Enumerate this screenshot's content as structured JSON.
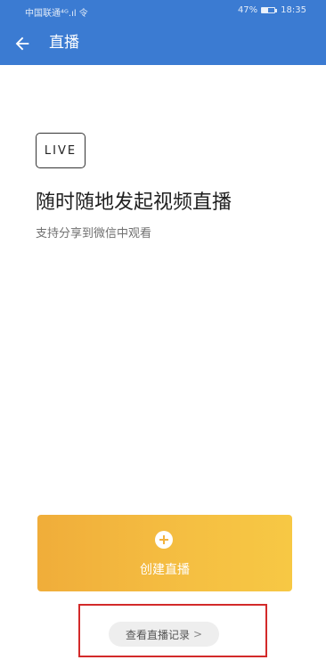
{
  "status_bar": {
    "carrier": "中国联通⁴ᴳ.ıl 令",
    "battery": "47%",
    "time": "18:35"
  },
  "app_bar": {
    "title": "直播"
  },
  "content": {
    "badge": "LIVE",
    "headline": "随时随地发起视频直播",
    "subline": "支持分享到微信中观看"
  },
  "create_button": {
    "label": "创建直播"
  },
  "records_link": {
    "label": "查看直播记录",
    "chevron": ">"
  },
  "colors": {
    "header": "#3b7bd2",
    "button_gradient_start": "#f0ad3a",
    "button_gradient_end": "#f7c844",
    "highlight": "#d32a2a"
  }
}
